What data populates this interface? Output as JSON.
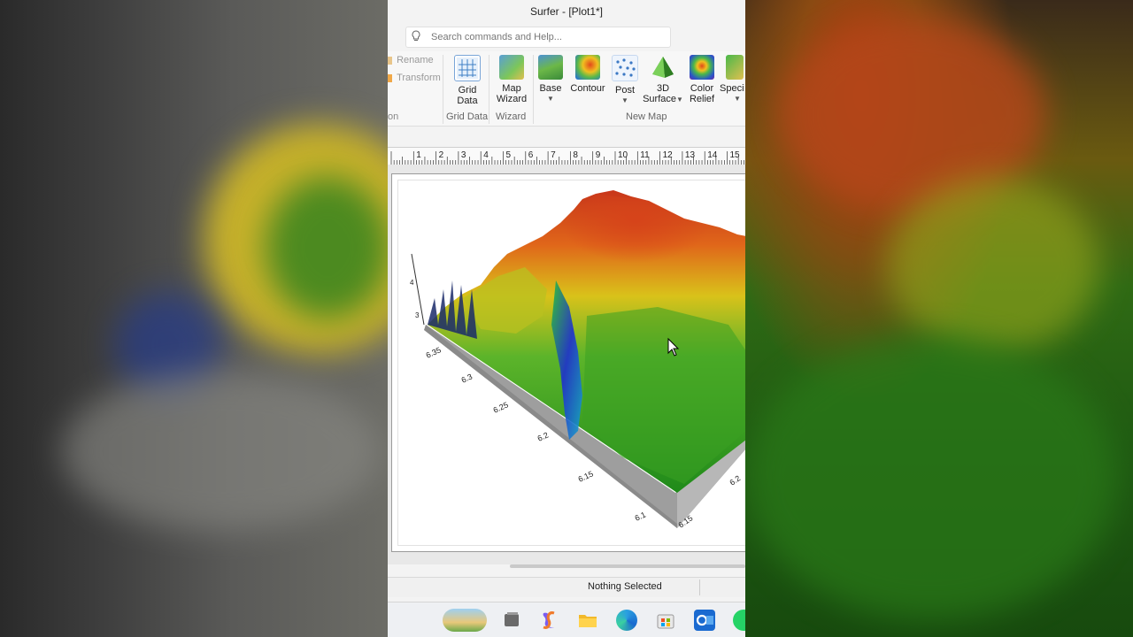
{
  "window": {
    "title": "Surfer - [Plot1*]"
  },
  "search": {
    "placeholder": "Search commands and Help..."
  },
  "ribbon": {
    "rename_label": "Rename",
    "transform_label": "Transform",
    "cut_group_label": "on",
    "grid_data_label": "Grid Data",
    "grid_data_line1": "Grid",
    "grid_data_line2": "Data",
    "map_wizard_line1": "Map",
    "map_wizard_line2": "Wizard",
    "base_label": "Base",
    "contour_label": "Contour",
    "post_label": "Post",
    "surface3d_line1": "3D",
    "surface3d_line2": "Surface",
    "color_relief_line1": "Color",
    "color_relief_line2": "Relief",
    "specialty_label": "Speci",
    "group_grid_data": "Grid Data",
    "group_wizard": "Wizard",
    "group_new_map": "New Map"
  },
  "ruler": {
    "labels": [
      "1",
      "2",
      "3",
      "4",
      "5",
      "6",
      "7",
      "8",
      "9",
      "10",
      "11",
      "12",
      "13",
      "14",
      "15"
    ]
  },
  "plot": {
    "axis_left": [
      "6.35",
      "6.3",
      "6.25",
      "6.2",
      "6.15",
      "6.1"
    ],
    "axis_right": [
      "6.15",
      "6.2"
    ],
    "z_ticks": [
      "4",
      "3"
    ]
  },
  "status": {
    "text": "Nothing Selected"
  },
  "colors": {
    "peak": "#c8361a",
    "mid": "#d9c21a",
    "low": "#2e9e1e",
    "valley": "#1d2fd0",
    "base_wall": "#9e9e9e"
  },
  "taskbar": {
    "icons": [
      "widgets-icon",
      "task-view-icon",
      "copilot-icon",
      "file-explorer-icon",
      "edge-icon",
      "store-icon",
      "outlook-icon",
      "whatsapp-icon"
    ]
  }
}
